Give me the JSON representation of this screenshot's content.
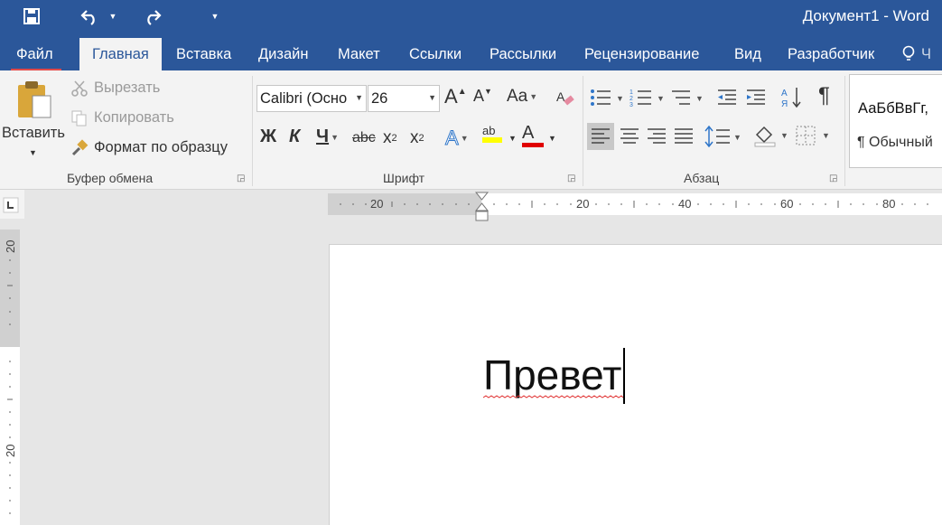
{
  "title": "Документ1 - Word",
  "tabs": {
    "file": "Файл",
    "home": "Главная",
    "insert": "Вставка",
    "design": "Дизайн",
    "layout": "Макет",
    "references": "Ссылки",
    "mailings": "Рассылки",
    "review": "Рецензирование",
    "view": "Вид",
    "developer": "Разработчик",
    "tell_me": "Ч"
  },
  "clipboard": {
    "paste": "Вставить",
    "cut": "Вырезать",
    "copy": "Копировать",
    "format_painter": "Формат по образцу",
    "label": "Буфер обмена"
  },
  "font": {
    "name": "Calibri (Осно",
    "size": "26",
    "bold": "Ж",
    "italic": "К",
    "underline": "Ч",
    "strike": "abc",
    "subscript": "x",
    "superscript": "x",
    "subscript_mark": "2",
    "superscript_mark": "2",
    "change_case": "Aa",
    "grow": "A",
    "shrink": "A",
    "text_effects": "A",
    "font_color": "A",
    "highlight": "ab",
    "label": "Шрифт"
  },
  "paragraph": {
    "pilcrow": "¶",
    "label": "Абзац"
  },
  "styles": {
    "preview": "АаБбВвГг,",
    "normal": "¶ Обычный"
  },
  "ruler": {
    "h_ticks": [
      "20",
      "20",
      "40",
      "60",
      "80"
    ],
    "v_ticks": [
      "20",
      "20"
    ]
  },
  "document": {
    "text": "Превет"
  },
  "colors": {
    "accent": "#2b579a",
    "file_underline": "#e24a4a",
    "highlight": "#ffff00",
    "font_color": "#e00000",
    "spell": "#e03030"
  }
}
